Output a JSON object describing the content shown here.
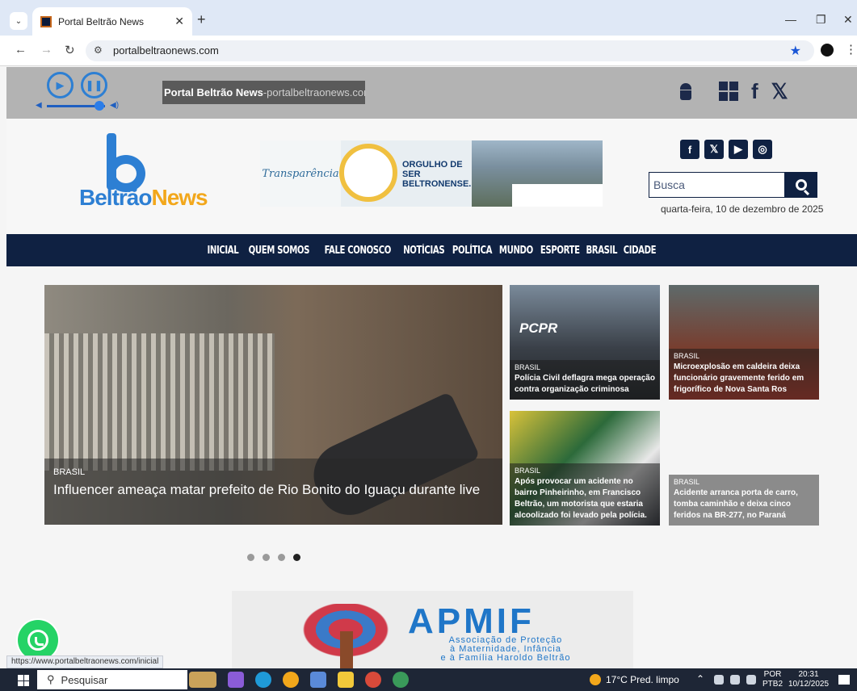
{
  "browser": {
    "tab_title": "Portal Beltrão News",
    "url": "portalbeltraonews.com",
    "status_url": "https://www.portalbeltraonews.com/inicial"
  },
  "radio": {
    "ticker_site": "Portal Beltrão News",
    "ticker_sep": " - ",
    "ticker_url": "portalbeltraonews.com",
    "volume": 0.9
  },
  "header": {
    "logo_main": "Beltrão",
    "logo_accent": "News",
    "banner_left": "Transparência",
    "banner_pride": "ORGULHO DE SER BELTRONENSE.",
    "search_placeholder": "Busca",
    "date": "quarta-feira, 10 de dezembro de 2025"
  },
  "nav": [
    "INICIAL",
    "QUEM SOMOS",
    "FALE CONOSCO",
    "NOTÍCIAS",
    "POLÍTICA",
    "MUNDO",
    "ESPORTE",
    "BRASIL",
    "CIDADE"
  ],
  "slider": {
    "main": {
      "category": "BRASIL",
      "title": "Influencer ameaça matar prefeito de Rio Bonito do Iguaçu durante live"
    },
    "cards": [
      {
        "category": "BRASIL",
        "title": "Polícia Civil deflagra mega operação contra organização criminosa",
        "badge": "PCPR"
      },
      {
        "category": "BRASIL",
        "title": "Microexplosão em caldeira deixa funcionário gravemente ferido em frigorífico de Nova Santa Ros"
      },
      {
        "category": "BRASIL",
        "title": "Após provocar um acidente no bairro Pinheirinho, em Francisco Beltrão, um motorista que estaria alcoolizado foi levado pela polícia."
      },
      {
        "category": "BRASIL",
        "title": "Acidente arranca porta de carro, tomba caminhão e deixa cinco feridos na BR-277, no Paraná"
      }
    ],
    "active_dot": 4
  },
  "ad": {
    "name": "APMIF",
    "line1": "Associação de Proteção",
    "line2": "à Maternidade, Infância",
    "line3": "e à Família Haroldo Beltrão"
  },
  "taskbar": {
    "search_text": "Pesquisar",
    "weather": "17°C  Pred. limpo",
    "lang1": "POR",
    "lang2": "PTB2",
    "time": "20:31",
    "date": "10/12/2025"
  },
  "colors": {
    "navy": "#0f2142",
    "brand_blue": "#2d7fd3",
    "brand_orange": "#f2a71b",
    "whatsapp": "#25d366"
  }
}
